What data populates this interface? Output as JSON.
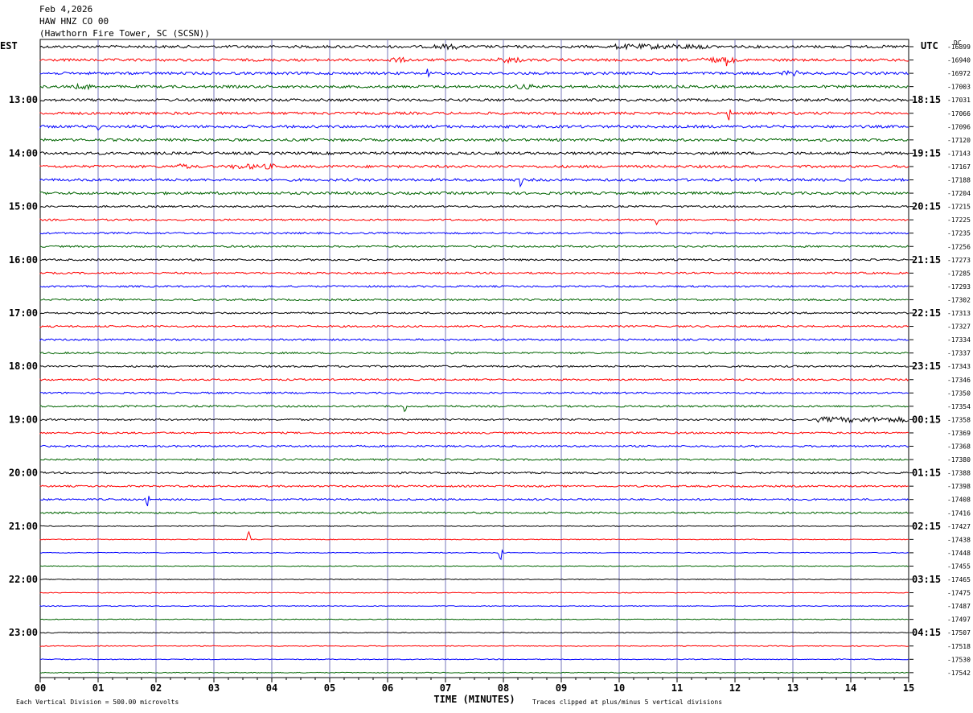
{
  "header": {
    "line1": "Feb 4,2026",
    "line2": "HAW HNZ CO 00",
    "line3": "(Hawthorn Fire Tower, SC (SCSN))"
  },
  "chart_data": {
    "type": "line",
    "left_zone_label": "EST",
    "right_zone_label": "UTC",
    "dc_label": "DC",
    "x_ticks": [
      "00",
      "01",
      "02",
      "03",
      "04",
      "05",
      "06",
      "07",
      "08",
      "09",
      "10",
      "11",
      "12",
      "13",
      "14",
      "15"
    ],
    "xlim": [
      0,
      15
    ],
    "xlabel": "TIME (MINUTES)",
    "footer_left": "Each Vertical Division =  500.00 microvolts",
    "footer_right": "Traces clipped at plus/minus 5 vertical divisions",
    "left_hour_labels": [
      "13:00",
      "14:00",
      "15:00",
      "16:00",
      "17:00",
      "18:00",
      "19:00",
      "20:00",
      "21:00",
      "22:00",
      "23:00"
    ],
    "right_hour_labels": [
      "18:15",
      "19:15",
      "20:15",
      "21:15",
      "22:15",
      "23:15",
      "00:15",
      "01:15",
      "02:15",
      "03:15",
      "04:15"
    ],
    "first_labeled_row": 4,
    "rows_per_hour": 4,
    "trace_colors": [
      "#000000",
      "#ff0000",
      "#0000ff",
      "#006400"
    ],
    "grid_color": "#7777bb",
    "dc_offsets": [
      "-16899",
      "-16940",
      "-16972",
      "-17003",
      "-17031",
      "-17066",
      "-17096",
      "-17120",
      "-17143",
      "-17167",
      "-17188",
      "-17204",
      "-17215",
      "-17225",
      "-17235",
      "-17256",
      "-17273",
      "-17285",
      "-17293",
      "-17302",
      "-17313",
      "-17327",
      "-17334",
      "-17337",
      "-17343",
      "-17346",
      "-17350",
      "-17354",
      "-17358",
      "-17369",
      "-17368",
      "-17380",
      "-17388",
      "-17398",
      "-17408",
      "-17416",
      "-17427",
      "-17438",
      "-17448",
      "-17455",
      "-17465",
      "-17475",
      "-17487",
      "-17497",
      "-17507",
      "-17518",
      "-17530",
      "-17542"
    ]
  }
}
